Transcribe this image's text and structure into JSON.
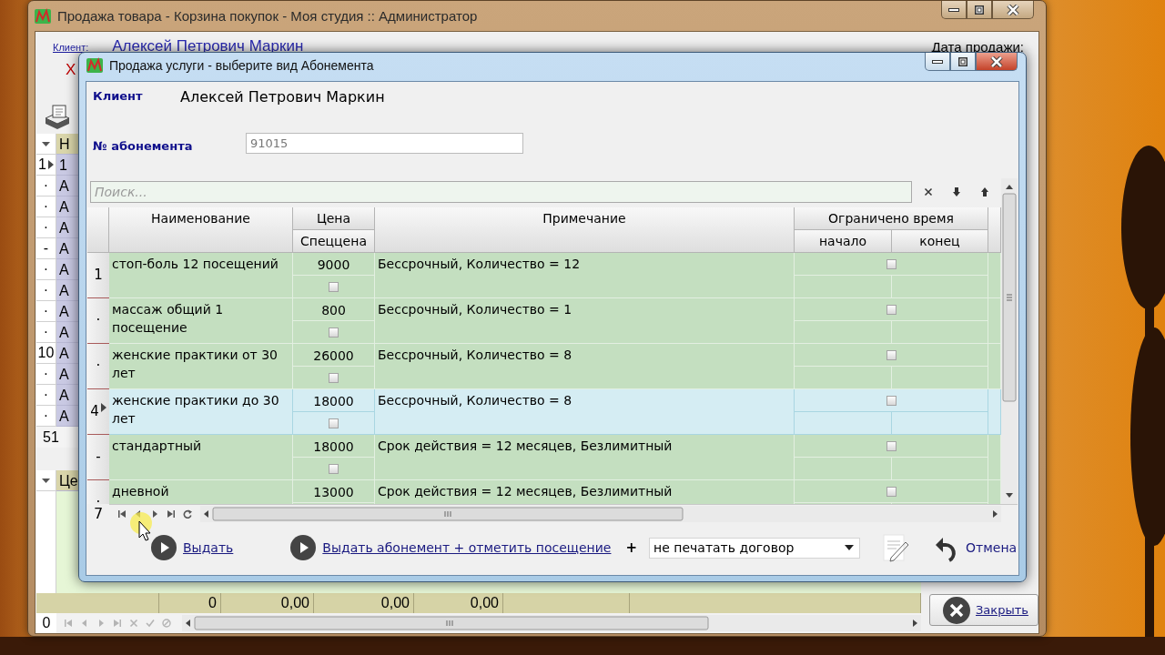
{
  "main_window": {
    "title": "Продажа товара - Корзина покупок - Моя студия :: Администратор",
    "client_label": "Клиент:",
    "client_name": "Алексей Петрович Маркин",
    "clear_mark": "X",
    "sale_date_label": "Дата продажи:",
    "items_grid": {
      "column_1": "Н",
      "rows": [
        {
          "indicator": "1",
          "current": true,
          "cell": "1"
        },
        {
          "indicator": "·",
          "current": false,
          "cell": "А"
        },
        {
          "indicator": "·",
          "current": false,
          "cell": "А"
        },
        {
          "indicator": "·",
          "current": false,
          "cell": "А"
        },
        {
          "indicator": "-",
          "current": false,
          "cell": "А"
        },
        {
          "indicator": "·",
          "current": false,
          "cell": "А"
        },
        {
          "indicator": "·",
          "current": false,
          "cell": "А"
        },
        {
          "indicator": "·",
          "current": false,
          "cell": "А"
        },
        {
          "indicator": "·",
          "current": false,
          "cell": "А"
        },
        {
          "indicator": "10",
          "current": false,
          "cell": "А"
        },
        {
          "indicator": "·",
          "current": false,
          "cell": "А"
        },
        {
          "indicator": "·",
          "current": false,
          "cell": "А"
        },
        {
          "indicator": "·",
          "current": false,
          "cell": "А"
        }
      ],
      "footer": "51"
    },
    "payments_grid": {
      "column_1": "Це",
      "totals": [
        "0",
        "0,00",
        "0,00",
        "0,00"
      ],
      "record_count": "0"
    },
    "close_button": "Закрыть"
  },
  "dialog": {
    "title": "Продажа услуги - выберите вид Абонемента",
    "client_label": "Клиент",
    "client_name": "Алексей Петрович Маркин",
    "number_label": "№ абонемента",
    "number_value": "91015",
    "search": {
      "placeholder": "Поиск..."
    },
    "header": {
      "name": "Наименование",
      "price": "Цена",
      "special_price": "Спеццена",
      "note": "Примечание",
      "time_limit": "Ограничено время",
      "start": "начало",
      "end": "конец"
    },
    "rows": [
      {
        "indicator": "1",
        "current": false,
        "selected": false,
        "name": "стоп-боль 12 посещений",
        "price": "9000",
        "special_price": false,
        "note": "Бессрочный, Количество = 12",
        "time_limited": false
      },
      {
        "indicator": "·",
        "current": false,
        "selected": false,
        "name": "массаж общий 1 посещение",
        "price": "800",
        "special_price": false,
        "note": "Бессрочный, Количество = 1",
        "time_limited": false
      },
      {
        "indicator": "·",
        "current": false,
        "selected": false,
        "name": "женские практики от 30 лет",
        "price": "26000",
        "special_price": false,
        "note": "Бессрочный, Количество = 8",
        "time_limited": false
      },
      {
        "indicator": "4",
        "current": true,
        "selected": true,
        "name": "женские практики до 30 лет",
        "price": "18000",
        "special_price": false,
        "note": "Бессрочный, Количество = 8",
        "time_limited": false
      },
      {
        "indicator": "-",
        "current": false,
        "selected": false,
        "name": "стандартный",
        "price": "18000",
        "special_price": false,
        "note": "Срок действия = 12 месяцев, Безлимитный",
        "time_limited": false
      },
      {
        "indicator": "·",
        "current": false,
        "selected": false,
        "name": "дневной",
        "price": "13000",
        "note": "Срок действия = 12 месяцев, Безлимитный",
        "time_limited": false
      }
    ],
    "record_count": "7",
    "actions": [
      "Выдать",
      "Выдать абонемент + отметить посещение"
    ],
    "plus": "+",
    "print_option": "не печатать договор",
    "cancel_button": "Отмена"
  }
}
